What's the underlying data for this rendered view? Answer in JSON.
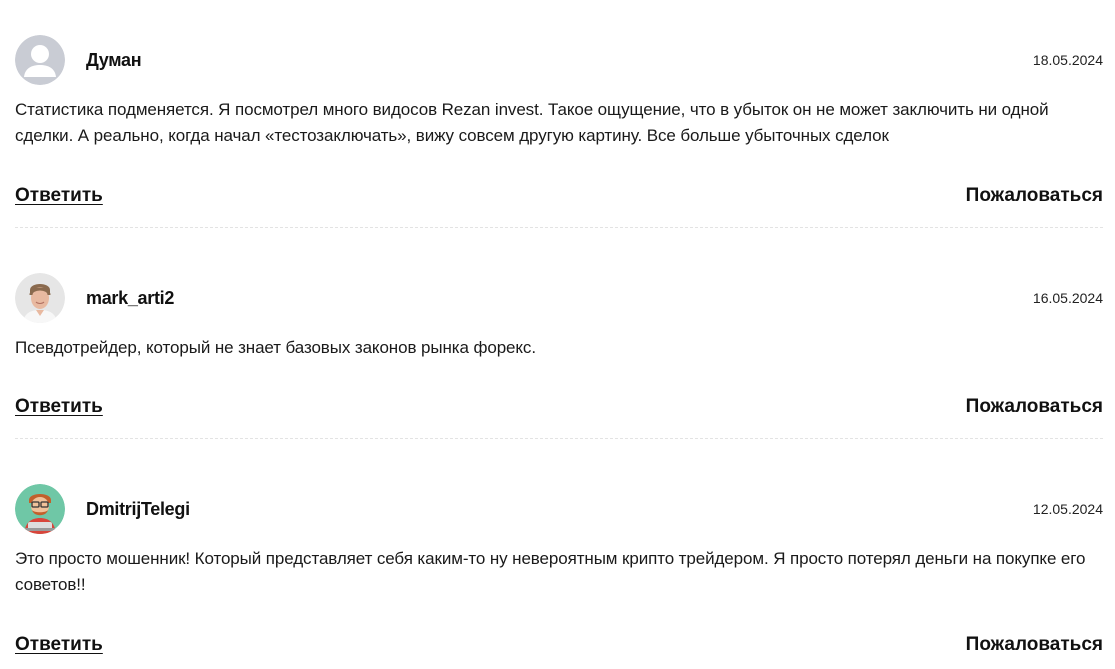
{
  "comments": [
    {
      "author": "Думан",
      "date": "18.05.2024",
      "text": "Статистика подменяется. Я посмотрел много видосов Rezan invest. Такое ощущение, что в убыток он не может заключить ни одной сделки. А реально, когда начал «тестозаключать», вижу совсем другую картину. Все больше убыточных сделок",
      "avatar_icon": "default-user-avatar",
      "reply_label": "Ответить",
      "report_label": "Пожаловаться"
    },
    {
      "author": "mark_arti2",
      "date": "16.05.2024",
      "text": "Псевдотрейдер, который не знает базовых законов рынка форекс.",
      "avatar_icon": "user-photo-avatar",
      "reply_label": "Ответить",
      "report_label": "Пожаловаться"
    },
    {
      "author": "DmitrijTelegi",
      "date": "12.05.2024",
      "text": "Это просто мошенник! Который представляет себя каким-то ну невероятным крипто трейдером. Я просто потерял деньги на покупке его советов!!",
      "avatar_icon": "cartoon-avatar",
      "reply_label": "Ответить",
      "report_label": "Пожаловаться"
    }
  ],
  "colors": {
    "text": "#1a1a1a",
    "divider": "#e3e3e3",
    "default_avatar_bg": "#c9ccd4",
    "cartoon_avatar_bg": "#6fc7a6"
  }
}
